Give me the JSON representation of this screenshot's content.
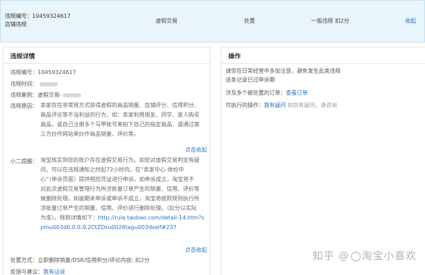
{
  "summary": {
    "violation_id": "违规编号：10459324617",
    "category": "店铺违规",
    "type": "虚假交易",
    "status": "处置",
    "level": "一般违规 扣2分",
    "collapse": "收起"
  },
  "detail": {
    "title": "违规详情",
    "id_row": "违规编号：10459324617",
    "time_label": "违规时间：",
    "case_label": "违规案例：",
    "case_value": "虚假交易-",
    "reason_label": "违规原因：",
    "reason_lines": [
      "卖家存在非常规方式获得虚假的商品销量、店铺评分、信用积分、",
      "商品评论等不当利益的行为，如：卖家利用朋友、同学、家人购买",
      "商品，或自己注册多个马甲账号来拍下自己的指定商品，或通过第",
      "三方炒作网站来炒作商品销量、评价等。"
    ],
    "collapse_1": "点击收起",
    "tip_label": "小二提醒：",
    "tip_lines": [
      "淘宝核实到您的账户存在虚假交易行为。如您对虚假交易判定有疑",
      "问，可以在违规通知之时起72小时内，在“卖家中心-体检中",
      "心”（申诉页面）提供相应凭证进行申诉。如申诉成立，淘宝将不",
      "对此次虚假交易管理行为所涉批量订单产生的销量、信用、评价等",
      "做删除处理。如逾期未申诉或申诉不成立，淘宝将按照规则执行所",
      "涉批量订单产生的销量、信用、评价进行删除处理。（扣分以实际",
      "为准）。规则详情如下："
    ],
    "rule_link_1": "http://rule.taobao.com/detail-14.htm?s",
    "rule_link_2": "pmu003d0.0.0.0.2CtZDsu0026tagu003dself#237",
    "collapse_2": "点击收起",
    "handle_row": "处置方式：立即删除销量/DSR/信用积分/评论内容; 扣2分",
    "feedback_label": "反馈与建议：",
    "feedback_link": "我有话说"
  },
  "ops": {
    "title": "操作",
    "warning_lines": [
      "请您在日常经营中多加注意，避免发生此类违规",
      "该条记录已过申诉期"
    ],
    "orders_label": "涉及多个被处置的订单：",
    "orders_link": "查看订单",
    "exec_label": "可执行的操作：",
    "exec_link": "我有疑问",
    "exec_hint": "如您有疑问，请咨询"
  },
  "watermark": {
    "text_1": "知乎 @",
    "text_2": "淘宝小喜欢"
  }
}
